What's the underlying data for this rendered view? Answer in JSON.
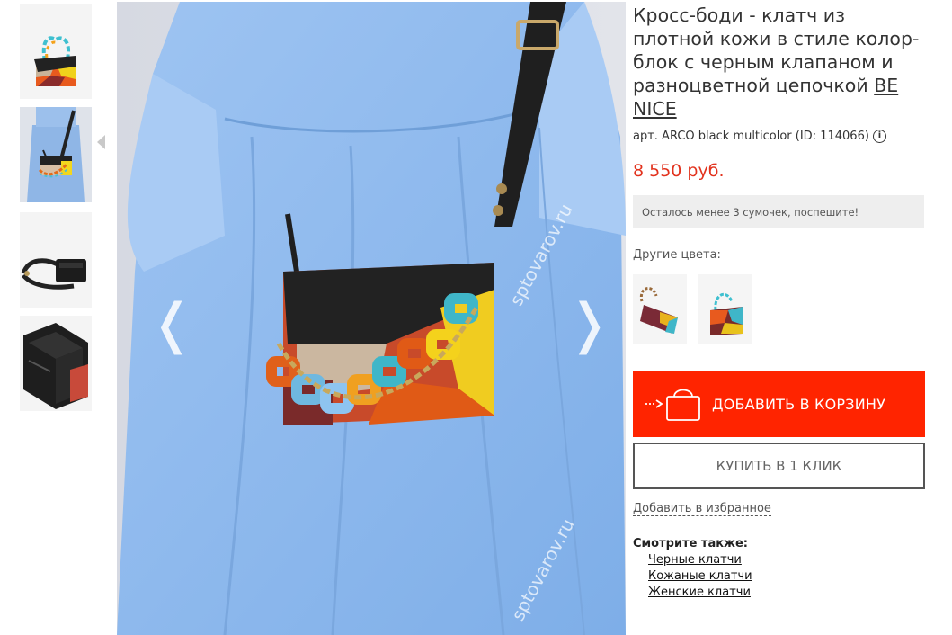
{
  "gallery": {
    "thumbnails": [
      {
        "name": "thumb-front"
      },
      {
        "name": "thumb-model"
      },
      {
        "name": "thumb-side"
      },
      {
        "name": "thumb-inside"
      }
    ],
    "active_index": 1,
    "prev_arrow": "❬",
    "next_arrow": "❭",
    "watermarks": [
      "sptovarov.ru",
      "sptovarov.ru"
    ]
  },
  "product": {
    "title": "Кросс-боди - клатч из плотной кожи в стиле колор-блок с черным клапаном и разноцветной цепочкой",
    "brand": "BE NICE",
    "sku_text": "арт. ARCO black multicolor (ID: 114066)",
    "info_icon": "i",
    "price": "8 550 руб.",
    "price_color": "#e2321d",
    "stock_note": "Осталось менее 3 сумочек, поспешите!",
    "other_colors_label": "Другие цвета:",
    "other_colors": [
      {
        "name": "burgundy-variant"
      },
      {
        "name": "multicolor-variant"
      }
    ]
  },
  "actions": {
    "add_to_cart": "ДОБАВИТЬ В КОРЗИНУ",
    "add_to_cart_color": "#ff2400",
    "buy_one_click": "КУПИТЬ В 1 КЛИК",
    "add_to_favorites": "Добавить в избранное"
  },
  "see_also": {
    "title": "Смотрите также:",
    "links": [
      "Черные клатчи",
      "Кожаные клатчи",
      "Женские клатчи"
    ]
  }
}
